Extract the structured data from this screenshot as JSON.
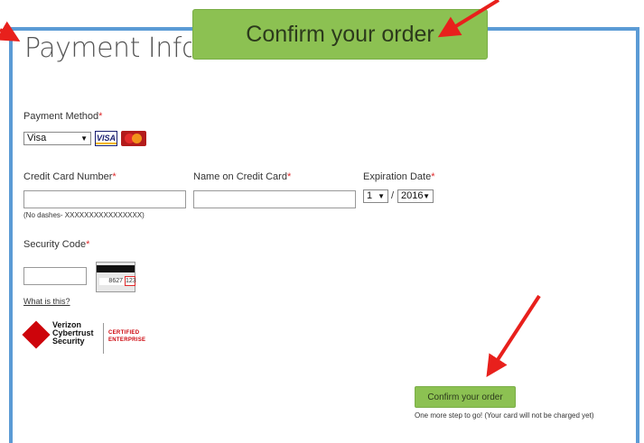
{
  "header": {
    "title": "Payment Inforr",
    "callout_label": "Confirm your order"
  },
  "payment_method": {
    "label": "Payment Method",
    "required_mark": "*",
    "selected": "Visa"
  },
  "cards": {
    "visa_text": "VISA"
  },
  "fields": {
    "card_number_label": "Credit Card Number",
    "name_label": "Name on Credit Card",
    "expiration_label": "Expiration Date",
    "required_mark": "*",
    "card_number_value": "",
    "name_value": "",
    "card_hint": "(No dashes- XXXXXXXXXXXXXXXX)",
    "exp_month": "1",
    "exp_separator": "/",
    "exp_year": "2016"
  },
  "security": {
    "label": "Security Code",
    "required_mark": "*",
    "value": "",
    "what_link": "What is this?",
    "card_sig_digits": "8627",
    "card_cvv_digits": "123"
  },
  "trust_logo": {
    "name_line1": "Verizon",
    "name_line2": "Cybertrust",
    "name_line3": "Security",
    "cert_line1": "CERTIFIED",
    "cert_line2": "ENTERPRISE"
  },
  "footer": {
    "confirm_label": "Confirm your order",
    "note": "One more step to go! (Your card will not be charged yet)"
  },
  "colors": {
    "frame": "#5b9bd5",
    "button_green": "#8cc152",
    "required": "#e0292b",
    "arrow": "#e8201c"
  }
}
